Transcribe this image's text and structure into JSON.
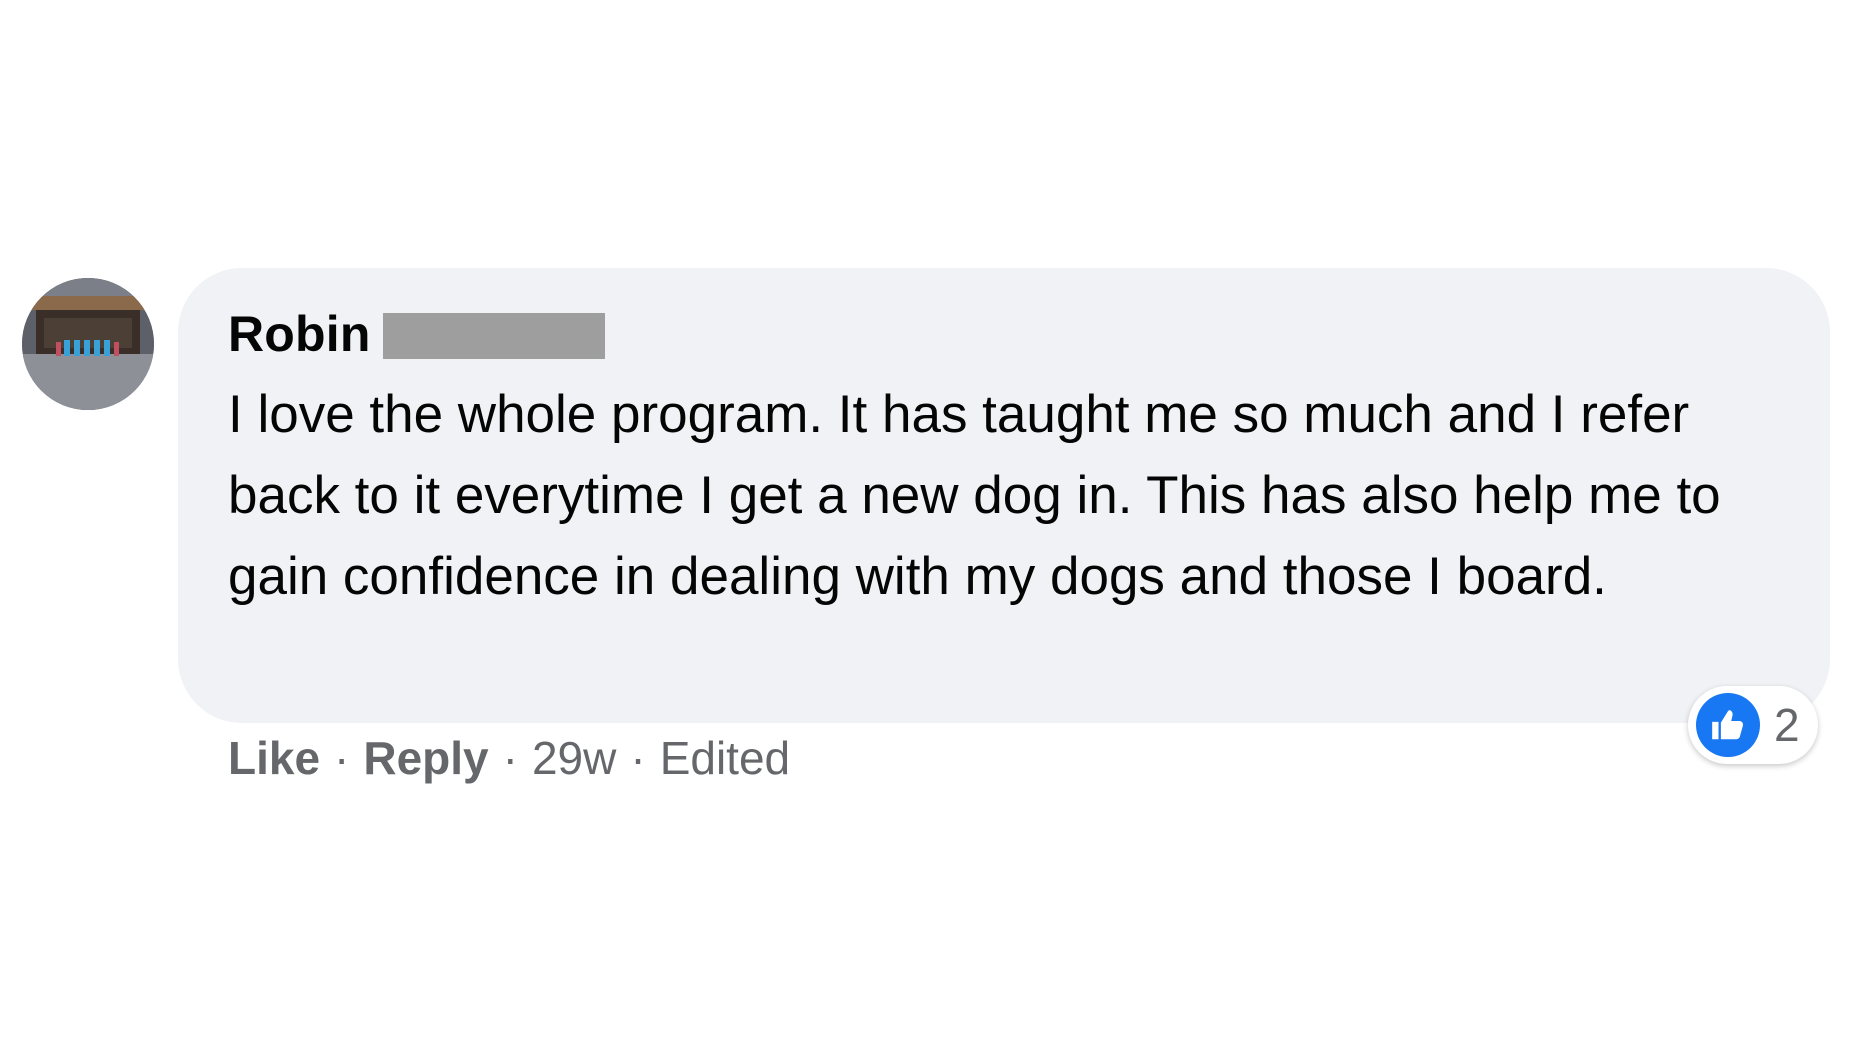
{
  "comment": {
    "author": "Robin",
    "text": "I love the whole program. It has taught me so much and I refer back to it everytime I get a new dog in. This has also help me to gain confidence in dealing with my dogs and those I board.",
    "actions": {
      "like_label": "Like",
      "reply_label": "Reply",
      "timestamp": "29w",
      "edited_label": "Edited",
      "separator": "·"
    },
    "reactions": {
      "icon": "thumbs-up-icon",
      "count": "2"
    }
  },
  "colors": {
    "bubble": "#f0f2f5",
    "text": "#050505",
    "meta": "#65676b",
    "like_blue": "#1877f2",
    "redaction": "#9e9e9e"
  }
}
